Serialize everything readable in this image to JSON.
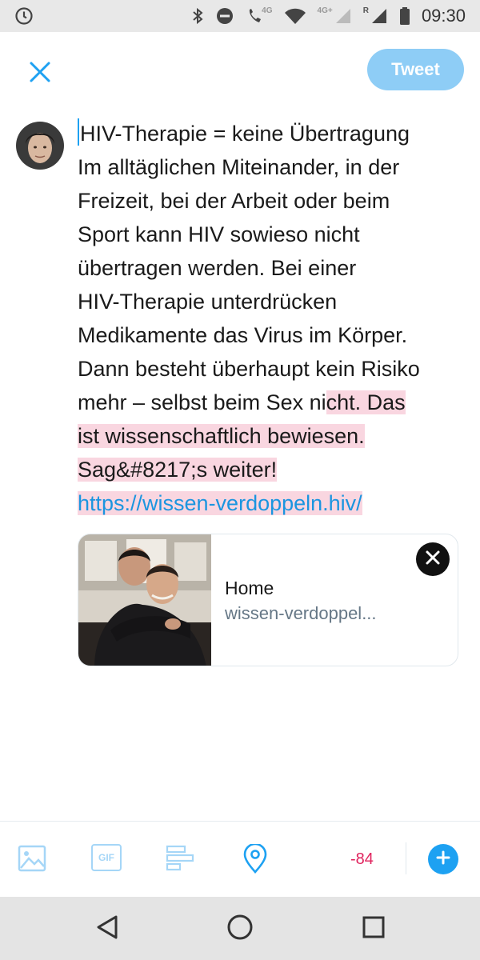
{
  "status_bar": {
    "time": "09:30",
    "network_labels": [
      "4G",
      "4G+",
      "R"
    ],
    "icons": [
      "clock-icon",
      "bluetooth-icon",
      "do-not-disturb-icon",
      "wifi-call-icon",
      "wifi-icon",
      "signal-icon",
      "battery-icon"
    ]
  },
  "header": {
    "close_icon": "close-icon",
    "tweet_label": "Tweet"
  },
  "compose": {
    "lines_normal": [
      "HIV-Therapie = keine Übertragung",
      "Im alltäglichen Miteinander, in der",
      "Freizeit, bei der Arbeit oder beim",
      "Sport kann HIV sowieso nicht",
      "übertragen werden. Bei einer",
      "HIV-Therapie unterdrücken",
      "Medikamente das Virus im Körper.",
      "Dann besteht überhaupt kein Risiko"
    ],
    "line9_normal": "mehr – selbst beim Sex ni",
    "line9_over": "cht. Das",
    "line10_over": "ist wissenschaftlich bewiesen.",
    "line11_over": "Sag&#8217;s weiter!",
    "link_text": "https://wissen-verdoppeln.hiv/"
  },
  "link_card": {
    "title": "Home",
    "domain": "wissen-verdoppel...",
    "close_icon": "close-icon"
  },
  "toolbar": {
    "icons": [
      "image-icon",
      "gif-icon",
      "poll-icon",
      "location-icon"
    ],
    "gif_label": "GIF",
    "char_counter": "-84",
    "add_icon": "plus-icon"
  },
  "nav_bar": {
    "icons": [
      "back-icon",
      "home-icon",
      "recents-icon"
    ]
  },
  "colors": {
    "accent": "#1da1f2",
    "tweet_button_disabled": "#8ecdf6",
    "over_limit_highlight": "#f9d6e0",
    "counter_negative": "#e0245e",
    "link": "#1b95e0"
  }
}
